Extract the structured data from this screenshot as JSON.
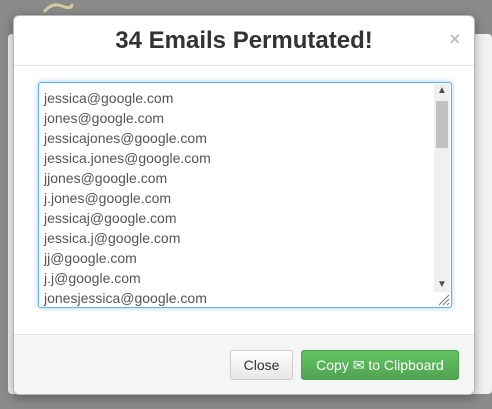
{
  "modal": {
    "title": "34 Emails Permutated!",
    "close_symbol": "×"
  },
  "emails": [
    "jessica@google.com",
    "jones@google.com",
    "jessicajones@google.com",
    "jessica.jones@google.com",
    "jjones@google.com",
    "j.jones@google.com",
    "jessicaj@google.com",
    "jessica.j@google.com",
    "jj@google.com",
    "j.j@google.com",
    "jonesjessica@google.com"
  ],
  "scroll": {
    "position_fraction": 0.0
  },
  "footer": {
    "close_label": "Close",
    "copy_label": "Copy ✉ to Clipboard"
  },
  "colors": {
    "primary_action": "#5cb85c",
    "focus_border": "#66afe9"
  }
}
